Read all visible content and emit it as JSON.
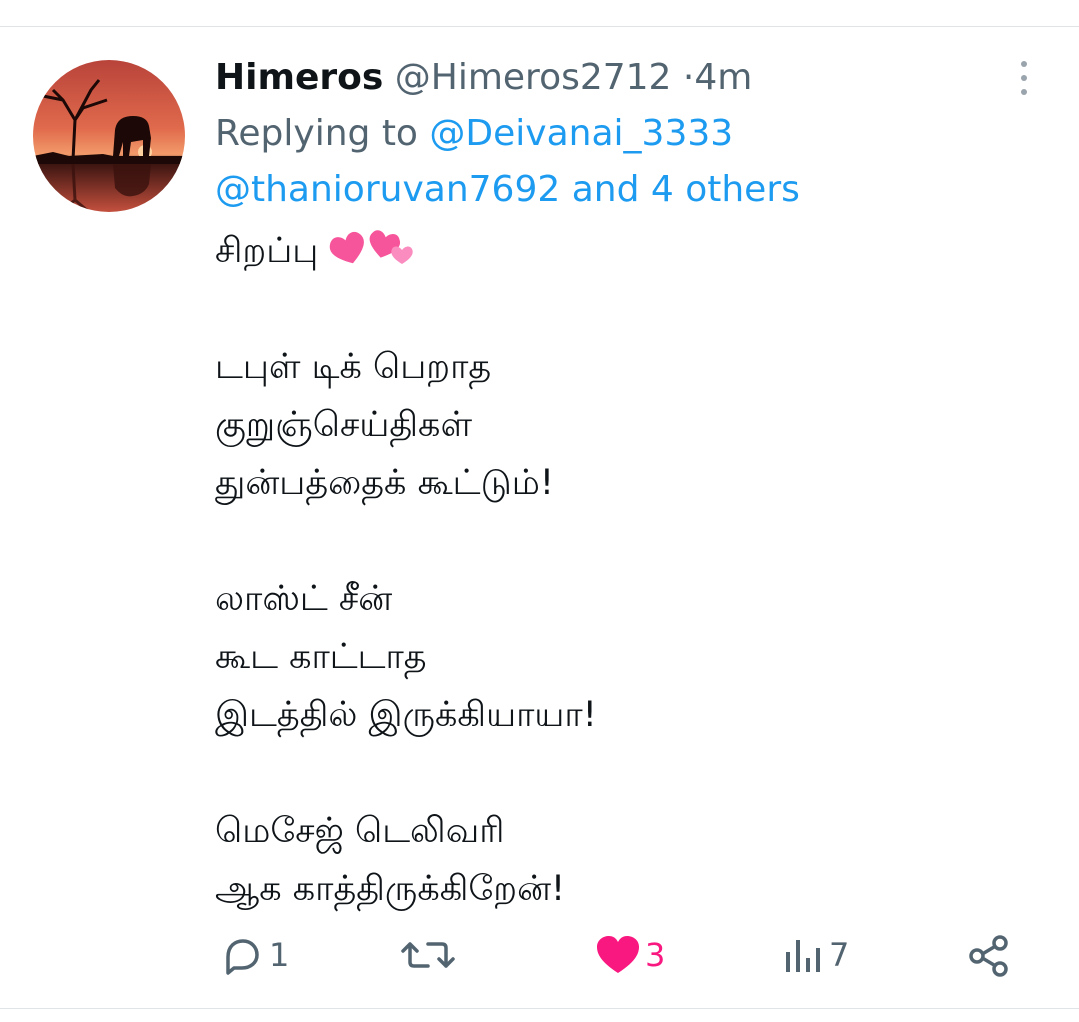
{
  "tweet": {
    "author_name": "Himeros",
    "author_handle": "@Himeros2712",
    "separator": "·",
    "time": "4m",
    "replying_prefix": "Replying to",
    "replying_first": "@Deivanai_3333",
    "replying_second": "@thanioruvan7692 and 4 others",
    "first_line": "சிறப்பு",
    "emoji_name": "two-hearts-emoji",
    "body_lines": [
      "",
      "டபுள் டிக் பெறாத",
      "குறுஞ்செய்திகள்",
      "துன்பத்தைக் கூட்டும்!",
      "",
      "லாஸ்ட் சீன்",
      "கூட காட்டாத",
      "இடத்தில் இருக்கியாயா!",
      "",
      "மெசேஜ் டெலிவரி",
      "ஆக காத்திருக்கிறேன்!"
    ]
  },
  "actions": {
    "reply_icon": "reply-icon",
    "reply_count": "1",
    "retweet_icon": "retweet-icon",
    "retweet_count": "",
    "like_icon": "heart-filled-icon",
    "like_count": "3",
    "views_icon": "views-chart-icon",
    "views_count": "7",
    "share_icon": "share-icon"
  },
  "colors": {
    "text": "#0f1419",
    "secondary": "#536471",
    "link": "#1d9bf0",
    "like": "#f91880",
    "divider": "#e1e4e6"
  }
}
